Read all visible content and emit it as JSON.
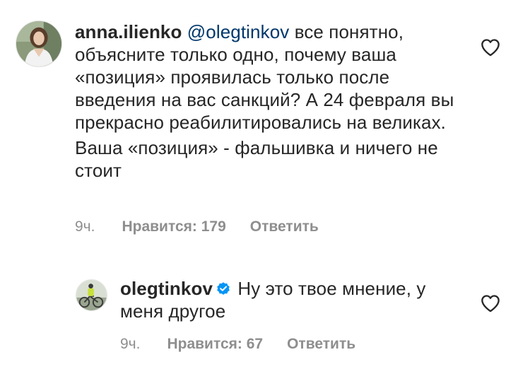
{
  "comments": [
    {
      "username": "anna.ilienko",
      "mention": "@olegtinkov",
      "text": "все понятно, объясните только одно, почему ваша «позиция» проявилась только после введения на вас санкций? А 24 февраля вы прекрасно реабилитировались на великах.",
      "text2": "Ваша «позиция» - фальшивка и ничего не стоит",
      "time": "9ч.",
      "likes": "Нравится: 179",
      "reply": "Ответить",
      "liked": false
    },
    {
      "username": "olegtinkov",
      "verified": true,
      "text": "Ну это твое мнение, у меня другое",
      "time": "9ч.",
      "likes": "Нравится: 67",
      "reply": "Ответить",
      "liked": false
    }
  ],
  "icons": {
    "like": "heart-outline-icon",
    "verified": "verified-badge-icon"
  },
  "colors": {
    "text": "#262626",
    "mention": "#00376b",
    "meta": "#8e8e8e",
    "verified": "#0095f6"
  }
}
